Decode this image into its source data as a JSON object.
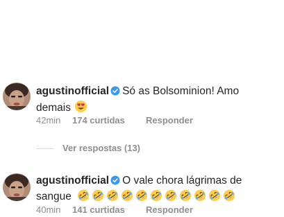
{
  "comments": [
    {
      "username": "agustinofficial",
      "text_line1": "Só as Bolsominion! Amo",
      "text_line2": "demais",
      "emoji": "heart-eyes-emoji",
      "time": "42min",
      "likes": "174 curtidas",
      "reply_label": "Responder"
    },
    {
      "username": "agustinofficial",
      "text_line1": "O vale chora lágrimas de",
      "text_line2": "sangue",
      "emoji": "rofl-emoji",
      "emoji_count": 11,
      "time": "40min",
      "likes": "141 curtidas",
      "reply_label": "Responder"
    }
  ],
  "replies_toggle": "Ver respostas (13)",
  "colors": {
    "text": "#262626",
    "secondary": "#8e8e8e",
    "verified": "#3897f0",
    "divider": "#dbdbdb"
  }
}
